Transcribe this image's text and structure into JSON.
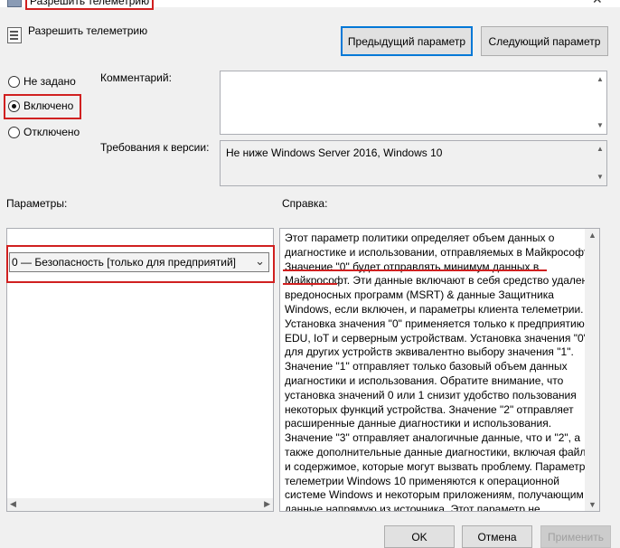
{
  "window": {
    "title": "Разрешить телеметрию",
    "close_glyph": "✕"
  },
  "header": {
    "policy_name": "Разрешить телеметрию",
    "prev_button": "Предыдущий параметр",
    "next_button": "Следующий параметр"
  },
  "state": {
    "options": [
      {
        "label": "Не задано",
        "checked": false
      },
      {
        "label": "Включено",
        "checked": true
      },
      {
        "label": "Отключено",
        "checked": false
      }
    ]
  },
  "comment": {
    "label": "Комментарий:",
    "value": ""
  },
  "version": {
    "label": "Требования к версии:",
    "value": "Не ниже Windows Server 2016, Windows 10"
  },
  "options_section": {
    "label": "Параметры:",
    "dropdown_value": "0 — Безопасность [только для предприятий]"
  },
  "help_section": {
    "label": "Справка:",
    "lines": [
      "Этот параметр политики определяет объем данных о",
      "диагностике и использовании, отправляемых в Майкрософт.",
      "Значение \"0\" будет отправлять минимум данных в",
      "Майкрософт. Эти данные включают в себя средство удаления",
      "вредоносных программ (MSRT) & данные Защитника",
      "Windows, если включен, и параметры клиента телеметрии.",
      "Установка значения \"0\" применяется только к предприятию,",
      "EDU, IoT и серверным устройствам. Установка значения \"0\"",
      "для других устройств эквивалентно выбору значения \"1\".",
      "Значение \"1\" отправляет только базовый объем данных",
      "диагностики и использования. Обратите внимание, что",
      "установка значений 0 или 1 снизит удобство пользования",
      "некоторых функций устройства. Значение \"2\" отправляет",
      "расширенные данные диагностики и использования.",
      "Значение \"3\" отправляет аналогичные данные, что и \"2\", а",
      "также дополнительные данные диагностики, включая файлы",
      "и содержимое, которые могут вызвать проблему. Параметры",
      "телеметрии Windows 10 применяются к операционной",
      "системе Windows и некоторым приложениям, получающим",
      "данные напрямую из источника. Этот параметр не"
    ]
  },
  "footer": {
    "ok": "OK",
    "cancel": "Отмена",
    "apply": "Применить"
  },
  "colors": {
    "highlight": "#d02020",
    "accent": "#0078d7"
  },
  "icons": [
    "window-icon",
    "policy-icon",
    "close-icon",
    "chevron-down-icon",
    "scroll-up-icon",
    "scroll-down-icon",
    "scroll-left-icon",
    "scroll-right-icon"
  ]
}
